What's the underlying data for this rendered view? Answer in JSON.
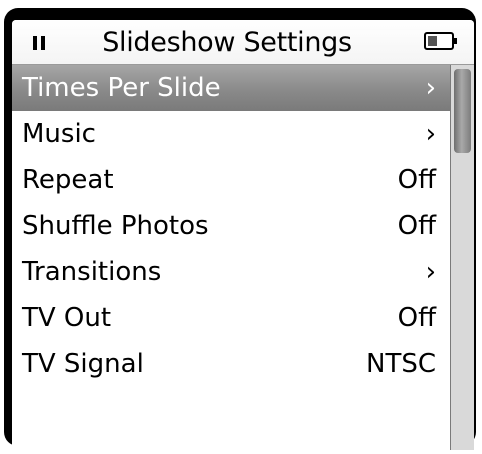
{
  "header": {
    "title": "Slideshow Settings",
    "status_icon": "pause-icon",
    "battery_icon": "battery-icon"
  },
  "menu": {
    "items": [
      {
        "label": "Times Per Slide",
        "value": "›",
        "selected": true
      },
      {
        "label": "Music",
        "value": "›",
        "selected": false
      },
      {
        "label": "Repeat",
        "value": "Off",
        "selected": false
      },
      {
        "label": "Shuffle Photos",
        "value": "Off",
        "selected": false
      },
      {
        "label": "Transitions",
        "value": "›",
        "selected": false
      },
      {
        "label": "TV Out",
        "value": "Off",
        "selected": false
      },
      {
        "label": "TV Signal",
        "value": "NTSC",
        "selected": false
      }
    ]
  },
  "colors": {
    "selection": "#8a8a8a",
    "frame": "#000000",
    "background": "#ffffff",
    "scrollbar_track": "#d9d9d9"
  }
}
